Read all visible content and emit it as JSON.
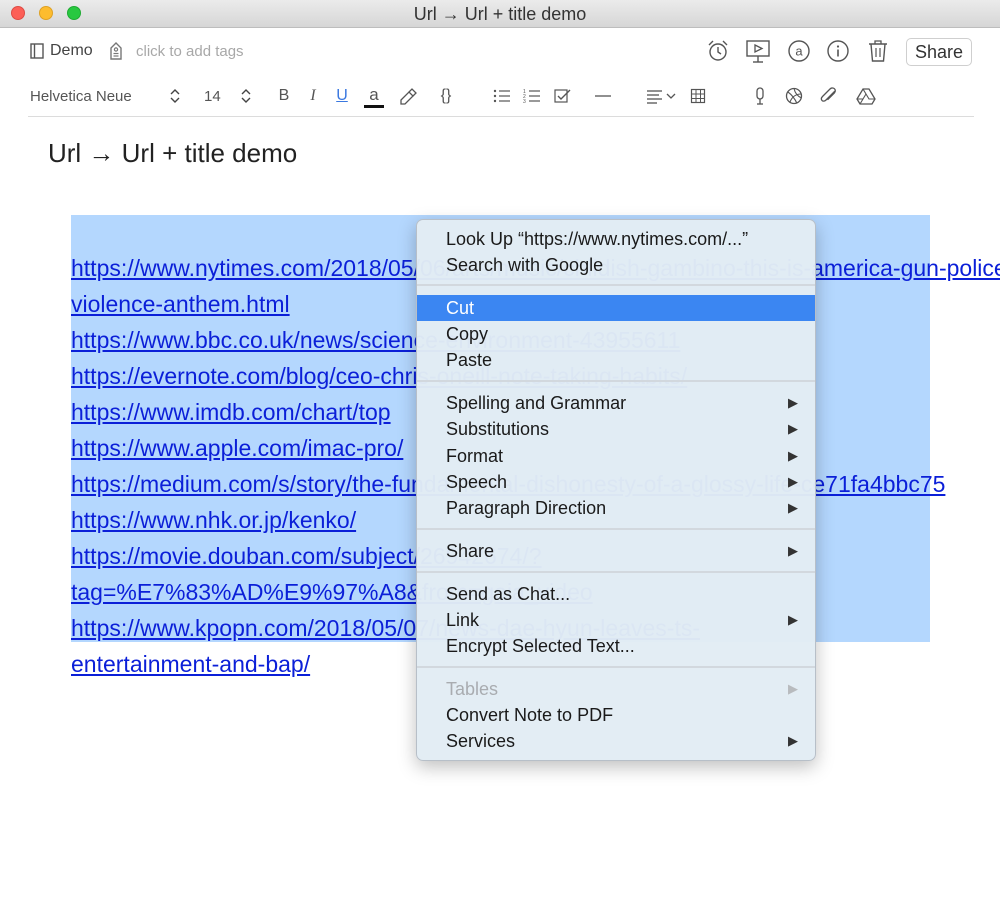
{
  "window": {
    "title": "Url → Url + title demo",
    "colors": {
      "close": "#fc5f57",
      "minimize": "#fdbc2e",
      "maximize": "#28c840"
    }
  },
  "header": {
    "notebook": "Demo",
    "tags_placeholder": "click to add tags",
    "share_label": "Share",
    "icons": [
      "alarm-clock-icon",
      "presentation-icon",
      "at-sign-icon",
      "info-icon",
      "trash-icon"
    ]
  },
  "toolbar": {
    "font_family": "Helvetica Neue",
    "font_size": "14",
    "bold": "B",
    "italic": "I",
    "underline": "U",
    "text_color": "a",
    "code": "{}",
    "icons": [
      "highlighter-icon",
      "bulleted-list-icon",
      "numbered-list-icon",
      "checkbox-icon",
      "horizontal-rule-icon",
      "align-icon",
      "table-icon",
      "microphone-icon",
      "sketch-icon",
      "attachment-icon",
      "google-drive-icon"
    ]
  },
  "note": {
    "title": "Url → Url + title demo",
    "selection_color": "#b4d7fe",
    "link_color": "#0b1fd8",
    "lines": [
      "https://www.nytimes.com/2018/05/06/arts/music/childish-gambino-this-is-america-gun-police-",
      "violence-anthem.html",
      "https://www.bbc.co.uk/news/science-environment-43955611",
      "https://evernote.com/blog/ceo-chris-oneill-note-taking-habits/",
      "https://www.imdb.com/chart/top",
      "https://www.apple.com/imac-pro/",
      "https://medium.com/s/story/the-fundamental-dishonesty-of-a-glossy-life-ce71fa4bbc75",
      "https://www.nhk.or.jp/kenko/",
      "https://movie.douban.com/subject/26942674/?",
      "tag=%E7%83%AD%E9%97%A8&from=gaia_video",
      "https://www.kpopn.com/2018/05/07/news-dae-hyun-leaves-ts-",
      "entertainment-and-bap/"
    ]
  },
  "context_menu": {
    "highlight_color": "#3b86f2",
    "groups": [
      [
        {
          "label": "Look Up “https://www.nytimes.com/...”"
        },
        {
          "label": "Search with Google"
        }
      ],
      [
        {
          "label": "Cut",
          "highlighted": true
        },
        {
          "label": "Copy"
        },
        {
          "label": "Paste"
        }
      ],
      [
        {
          "label": "Spelling and Grammar",
          "submenu": true
        },
        {
          "label": "Substitutions",
          "submenu": true
        },
        {
          "label": "Format",
          "submenu": true
        },
        {
          "label": "Speech",
          "submenu": true
        },
        {
          "label": "Paragraph Direction",
          "submenu": true
        }
      ],
      [
        {
          "label": "Share",
          "submenu": true
        }
      ],
      [
        {
          "label": "Send as Chat..."
        },
        {
          "label": "Link",
          "submenu": true
        },
        {
          "label": "Encrypt Selected Text..."
        }
      ],
      [
        {
          "label": "Tables",
          "submenu": true,
          "disabled": true
        },
        {
          "label": "Convert Note to PDF"
        },
        {
          "label": "Services",
          "submenu": true
        }
      ]
    ]
  }
}
